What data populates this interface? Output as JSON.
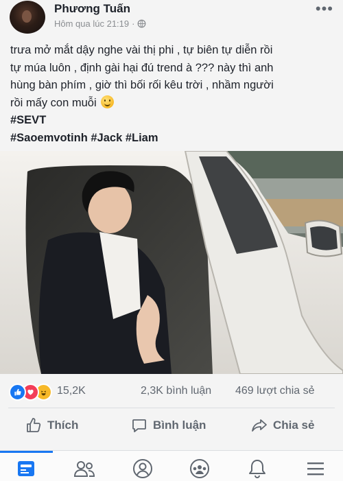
{
  "post": {
    "author": "Phương Tuấn",
    "timestamp": "Hôm qua lúc 21:19",
    "separator": "·",
    "text_lines": [
      "trưa mở mắt dậy nghe vài thị phi , tự biên tự diễn rồi",
      "tự múa luôn , định gài hại đú trend à ??? này thì anh",
      "hùng bàn phím , giờ thì bối rối kêu trời , nhầm người",
      "rồi mấy con muỗi"
    ],
    "hashtags_line1": "#SEVT",
    "hashtags_line2": "#Saoemvotinh #Jack #Liam"
  },
  "stats": {
    "reactions": "15,2K",
    "comments": "2,3K bình luận",
    "shares": "469 lượt chia sẻ"
  },
  "actions": {
    "like": "Thích",
    "comment": "Bình luận",
    "share": "Chia sẻ"
  },
  "nav": [
    "news-feed",
    "friends",
    "profile",
    "groups",
    "notifications",
    "menu"
  ],
  "colors": {
    "accent": "#1877f2",
    "text": "#1d2129",
    "secondary_text": "#606770",
    "love": "#f33e58",
    "haha": "#f7b928"
  }
}
